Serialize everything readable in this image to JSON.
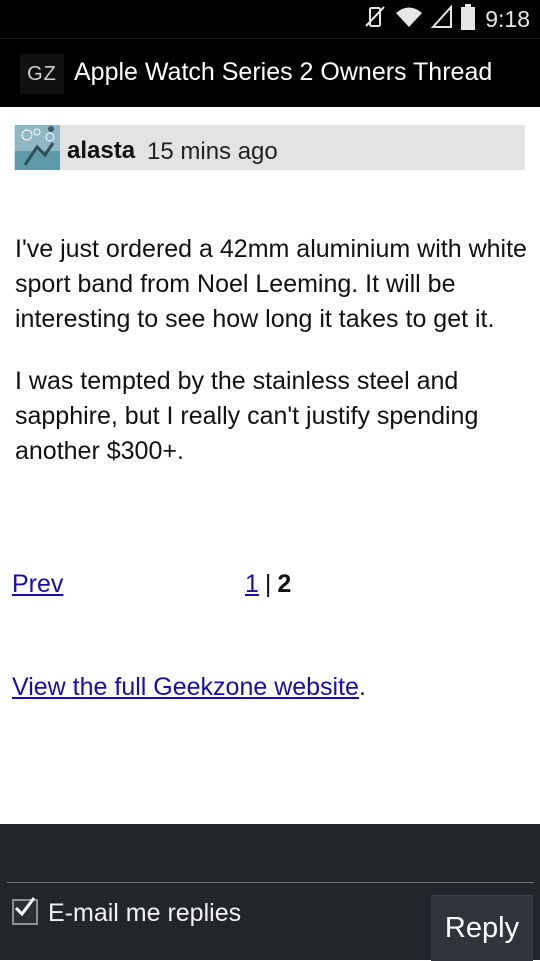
{
  "status_bar": {
    "time": "9:18",
    "icons": [
      "vibrate-mute-icon",
      "wifi-icon",
      "signal-icon",
      "battery-icon"
    ]
  },
  "action_bar": {
    "logo_text": "GZ",
    "title": "Apple Watch Series 2 Owners Thread"
  },
  "post": {
    "author": "alasta",
    "time_ago": "15 mins ago",
    "paragraphs": [
      "I've just ordered a 42mm aluminium with white sport band from Noel Leeming. It will be interesting to see how long it takes to get it.",
      "I was tempted by the stainless steel and sapphire, but I really can't justify spending another $300+."
    ]
  },
  "pagination": {
    "prev_label": "Prev",
    "page_1": "1",
    "separator": "|",
    "current_page": "2"
  },
  "footer": {
    "full_site_link": "View the full Geekzone website",
    "trailing": "."
  },
  "reply": {
    "input_value": "",
    "email_replies_label": "E-mail me replies",
    "email_replies_checked": true,
    "reply_button": "Reply"
  },
  "colors": {
    "link": "#1a0dab",
    "header_bg": "#000000",
    "post_header_bg": "#e3e3e3",
    "reply_panel_bg": "#22262b"
  }
}
